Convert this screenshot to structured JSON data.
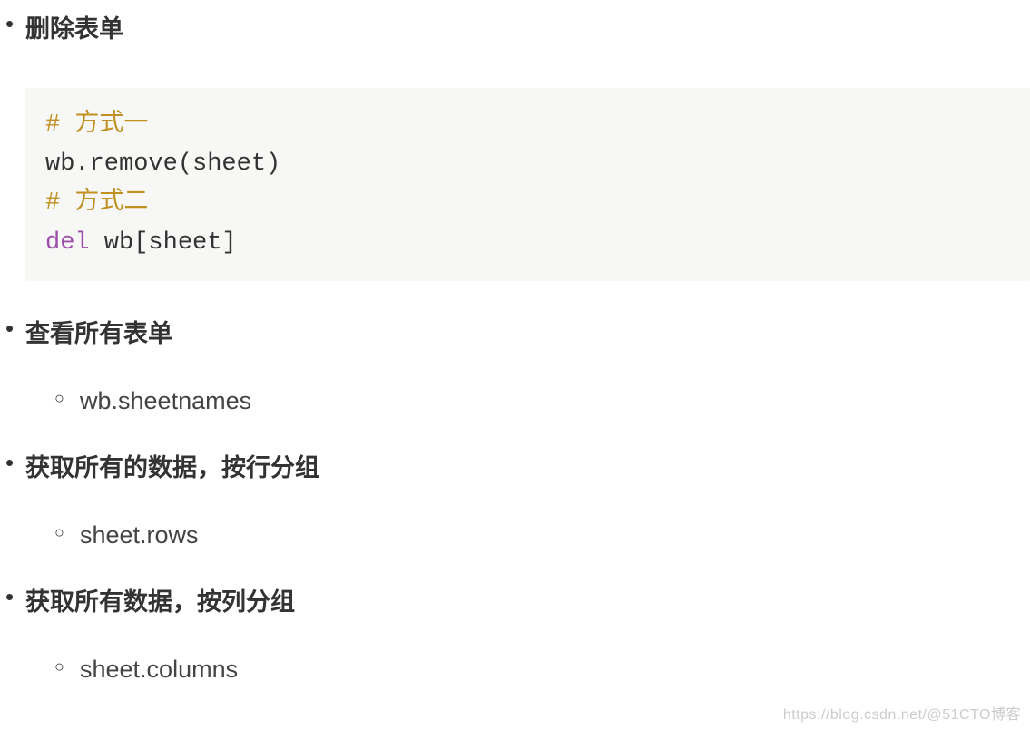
{
  "items": [
    {
      "title": "删除表单",
      "code": {
        "line1_comment": "# 方式一",
        "line2": "wb.remove(sheet)",
        "line3_comment": "# 方式二",
        "line4_keyword": "del",
        "line4_rest": " wb[sheet]"
      }
    },
    {
      "title": "查看所有表单",
      "sub": [
        "wb.sheetnames"
      ]
    },
    {
      "title": "获取所有的数据，按行分组",
      "sub": [
        "sheet.rows"
      ]
    },
    {
      "title": "获取所有数据，按列分组",
      "sub": [
        "sheet.columns"
      ]
    }
  ],
  "watermark": "https://blog.csdn.net/@51CTO博客"
}
